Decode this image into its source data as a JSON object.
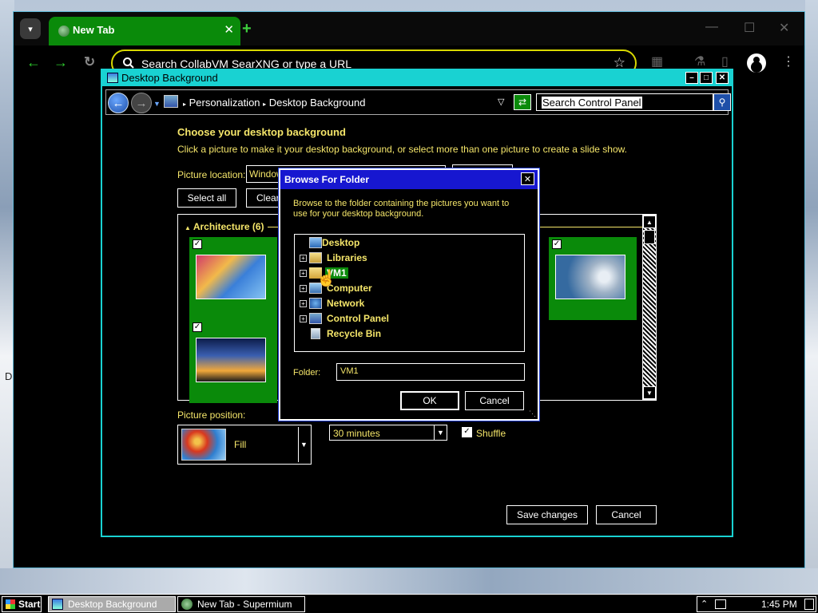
{
  "browser": {
    "tab_title": "New Tab",
    "omnibox_placeholder": "Search CollabVM SearXNG or type a URL"
  },
  "control_panel": {
    "window_title": "Desktop Background",
    "breadcrumb": [
      "Personalization",
      "Desktop Background"
    ],
    "search_placeholder": "Search Control Panel",
    "heading": "Choose your desktop background",
    "subheading": "Click a picture to make it your desktop background, or select more than one picture to create a slide show.",
    "picture_location_label": "Picture location:",
    "picture_location_value": "Window",
    "select_all_label": "Select all",
    "clear_all_label": "Clear",
    "group_header": "Architecture (6)",
    "picture_position_label": "Picture position:",
    "picture_position_value": "Fill",
    "interval_value": "30 minutes",
    "shuffle_label": "Shuffle",
    "save_label": "Save changes",
    "cancel_label": "Cancel"
  },
  "dialog": {
    "title": "Browse For Folder",
    "description": "Browse to the folder containing the pictures you want to use for your desktop background.",
    "tree": [
      {
        "label": "Desktop",
        "icon": "desktop-icon",
        "expandable": false,
        "selected": false
      },
      {
        "label": "Libraries",
        "icon": "libraries-icon",
        "expandable": true,
        "selected": false
      },
      {
        "label": "VM1",
        "icon": "user-folder-icon",
        "expandable": true,
        "selected": true
      },
      {
        "label": "Computer",
        "icon": "computer-icon",
        "expandable": true,
        "selected": false
      },
      {
        "label": "Network",
        "icon": "network-icon",
        "expandable": true,
        "selected": false
      },
      {
        "label": "Control Panel",
        "icon": "control-panel-icon",
        "expandable": true,
        "selected": false
      },
      {
        "label": "Recycle Bin",
        "icon": "recycle-bin-icon",
        "expandable": false,
        "selected": false
      }
    ],
    "folder_label": "Folder:",
    "folder_value": "VM1",
    "ok_label": "OK",
    "cancel_label": "Cancel"
  },
  "taskbar": {
    "start_label": "Start",
    "tasks": [
      "Desktop Background",
      "New Tab - Supermium"
    ],
    "clock": "1:45 PM"
  },
  "desktop": {
    "partial_letter": "D"
  },
  "colors": {
    "accent_green": "#0a8a0a",
    "label_yellow": "#f5e66a",
    "title_cyan": "#19d2d2",
    "dialog_blue": "#1717d0"
  }
}
